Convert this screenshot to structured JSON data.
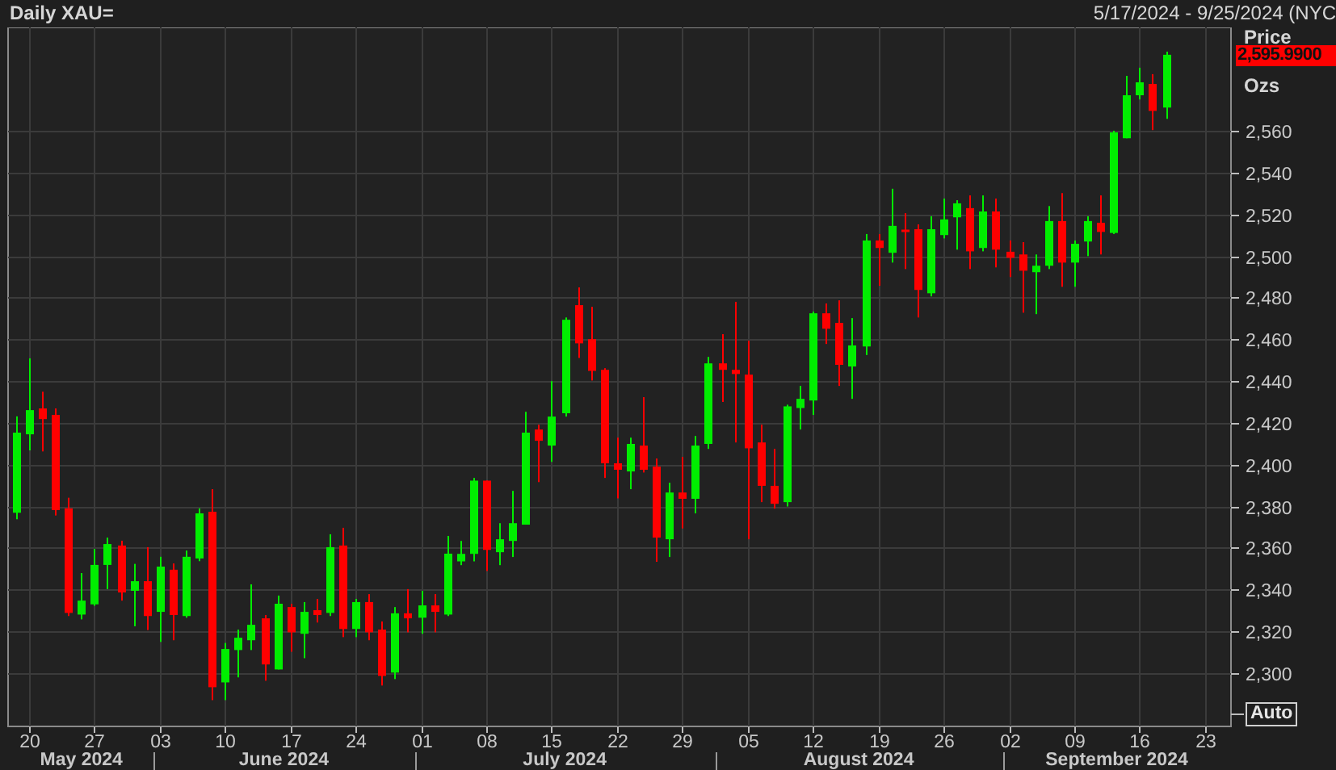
{
  "header": {
    "title": "Daily XAU=",
    "date_range": "5/17/2024 - 9/25/2024 (NYC"
  },
  "chart": {
    "price_axis": {
      "title": "Price",
      "last_price": "2,595.9900",
      "unit": "Ozs",
      "auto_button": "Auto"
    },
    "chart_data": {
      "type": "candlestick",
      "grid": true,
      "ylim": [
        2274.5,
        2609.5
      ],
      "categories": [
        null,
        "20",
        null,
        null,
        null,
        null,
        "27",
        null,
        null,
        null,
        null,
        "03",
        null,
        null,
        null,
        null,
        "10",
        null,
        null,
        null,
        null,
        "17",
        null,
        null,
        null,
        null,
        "24",
        null,
        null,
        null,
        null,
        "01",
        null,
        null,
        null,
        null,
        "08",
        null,
        null,
        null,
        null,
        "15",
        null,
        null,
        null,
        null,
        "22",
        null,
        null,
        null,
        null,
        "29",
        null,
        null,
        null,
        null,
        "05",
        null,
        null,
        null,
        null,
        "12",
        null,
        null,
        null,
        null,
        "19",
        null,
        null,
        null,
        null,
        "26",
        null,
        null,
        null,
        null,
        "02",
        null,
        null,
        null,
        null,
        "09",
        null,
        null,
        null,
        null,
        "16",
        null,
        null,
        null,
        null,
        "23"
      ],
      "ohlc": [
        [
          2376.9,
          2423.1,
          2373.8,
          2415.3
        ],
        [
          2414.5,
          2450.9,
          2406.8,
          2426.1
        ],
        [
          2426.9,
          2434.9,
          2406.3,
          2421.8
        ],
        [
          2423.8,
          2426.9,
          2375.6,
          2378.2
        ],
        [
          2379.0,
          2384.1,
          2327.4,
          2328.9
        ],
        [
          2328.1,
          2348.0,
          2325.8,
          2334.8
        ],
        [
          2333.0,
          2359.6,
          2332.3,
          2351.9
        ],
        [
          2351.9,
          2365.0,
          2340.3,
          2361.9
        ],
        [
          2361.2,
          2363.5,
          2334.8,
          2338.7
        ],
        [
          2339.5,
          2352.4,
          2322.5,
          2344.1
        ],
        [
          2344.1,
          2360.4,
          2320.7,
          2327.4
        ],
        [
          2329.4,
          2355.8,
          2315.0,
          2351.1
        ],
        [
          2349.6,
          2352.6,
          2315.8,
          2327.9
        ],
        [
          2327.4,
          2358.8,
          2326.6,
          2355.8
        ],
        [
          2355.0,
          2379.0,
          2353.7,
          2376.6
        ],
        [
          2377.4,
          2388.2,
          2287.1,
          2293.3
        ],
        [
          2295.6,
          2314.5,
          2287.1,
          2311.6
        ],
        [
          2311.1,
          2320.9,
          2298.0,
          2317.0
        ],
        [
          2315.8,
          2342.6,
          2311.1,
          2323.2
        ],
        [
          2326.3,
          2327.9,
          2296.4,
          2304.2
        ],
        [
          2301.8,
          2337.2,
          2301.8,
          2333.3
        ],
        [
          2331.7,
          2333.3,
          2310.3,
          2319.6
        ],
        [
          2318.9,
          2334.1,
          2307.2,
          2329.4
        ],
        [
          2330.2,
          2335.6,
          2324.3,
          2327.9
        ],
        [
          2328.9,
          2366.6,
          2327.4,
          2360.4
        ],
        [
          2361.2,
          2369.7,
          2317.3,
          2321.2
        ],
        [
          2321.2,
          2335.6,
          2317.3,
          2334.1
        ],
        [
          2334.1,
          2337.9,
          2315.8,
          2319.6
        ],
        [
          2320.9,
          2324.8,
          2294.1,
          2298.7
        ],
        [
          2300.3,
          2331.7,
          2297.2,
          2328.7
        ],
        [
          2328.7,
          2340.3,
          2319.6,
          2326.3
        ],
        [
          2326.6,
          2339.5,
          2318.9,
          2332.5
        ],
        [
          2332.5,
          2337.9,
          2319.6,
          2329.4
        ],
        [
          2328.1,
          2365.8,
          2327.4,
          2357.3
        ],
        [
          2353.6,
          2363.4,
          2351.8,
          2357.2
        ],
        [
          2357.2,
          2393.6,
          2353.6,
          2392.3
        ],
        [
          2392.3,
          2392.3,
          2349.0,
          2359.1
        ],
        [
          2358.0,
          2371.9,
          2351.8,
          2364.2
        ],
        [
          2363.4,
          2387.4,
          2355.7,
          2371.9
        ],
        [
          2371.2,
          2425.3,
          2371.2,
          2415.3
        ],
        [
          2416.8,
          2419.1,
          2391.6,
          2411.4
        ],
        [
          2409.1,
          2440.0,
          2401.3,
          2423.0
        ],
        [
          2424.6,
          2470.5,
          2423.0,
          2469.4
        ],
        [
          2476.4,
          2484.9,
          2451.1,
          2458.1
        ],
        [
          2460.1,
          2475.6,
          2440.3,
          2444.9
        ],
        [
          2445.4,
          2446.2,
          2393.6,
          2400.6
        ],
        [
          2400.6,
          2412.9,
          2383.8,
          2397.5
        ],
        [
          2396.7,
          2412.9,
          2388.2,
          2409.9
        ],
        [
          2409.1,
          2432.3,
          2396.2,
          2397.5
        ],
        [
          2399.0,
          2402.9,
          2353.4,
          2365.0
        ],
        [
          2364.2,
          2391.3,
          2355.7,
          2386.6
        ],
        [
          2386.6,
          2403.7,
          2369.4,
          2383.6
        ],
        [
          2383.6,
          2413.7,
          2376.6,
          2409.1
        ],
        [
          2409.9,
          2451.6,
          2407.5,
          2448.5
        ],
        [
          2448.5,
          2462.5,
          2430.0,
          2445.4
        ],
        [
          2445.4,
          2478.0,
          2410.6,
          2443.4
        ],
        [
          2443.1,
          2459.4,
          2364.2,
          2407.8
        ],
        [
          2410.6,
          2419.1,
          2382.0,
          2389.8
        ],
        [
          2389.8,
          2407.5,
          2378.9,
          2381.2
        ],
        [
          2382.0,
          2428.7,
          2379.9,
          2427.9
        ],
        [
          2427.1,
          2437.7,
          2416.8,
          2431.5
        ],
        [
          2430.7,
          2473.3,
          2423.8,
          2472.5
        ],
        [
          2472.5,
          2477.2,
          2457.8,
          2465.1
        ],
        [
          2467.9,
          2478.7,
          2437.7,
          2447.8
        ],
        [
          2447.0,
          2470.2,
          2431.5,
          2457.1
        ],
        [
          2456.6,
          2510.5,
          2452.5,
          2507.4
        ],
        [
          2507.4,
          2510.5,
          2485.7,
          2503.8
        ],
        [
          2501.5,
          2532.2,
          2496.8,
          2514.4
        ],
        [
          2512.6,
          2520.5,
          2493.7,
          2512.0
        ],
        [
          2512.8,
          2515.1,
          2470.5,
          2483.7
        ],
        [
          2482.1,
          2519.0,
          2480.6,
          2512.8
        ],
        [
          2510.0,
          2527.5,
          2508.4,
          2517.5
        ],
        [
          2518.5,
          2526.7,
          2503.0,
          2525.2
        ],
        [
          2522.9,
          2529.0,
          2493.7,
          2502.2
        ],
        [
          2503.8,
          2529.0,
          2502.2,
          2521.3
        ],
        [
          2521.3,
          2527.5,
          2494.5,
          2503.0
        ],
        [
          2502.0,
          2507.4,
          2489.9,
          2499.1
        ],
        [
          2500.7,
          2506.6,
          2472.8,
          2492.9
        ],
        [
          2492.2,
          2500.7,
          2472.1,
          2495.3
        ],
        [
          2495.3,
          2523.9,
          2493.7,
          2516.7
        ],
        [
          2516.7,
          2530.1,
          2485.2,
          2496.8
        ],
        [
          2496.8,
          2507.4,
          2485.2,
          2505.8
        ],
        [
          2506.9,
          2519.0,
          2499.9,
          2516.7
        ],
        [
          2515.9,
          2529.0,
          2500.7,
          2511.5
        ],
        [
          2511.0,
          2560.0,
          2510.5,
          2559.2
        ],
        [
          2556.4,
          2586.3,
          2556.4,
          2577.0
        ],
        [
          2577.0,
          2590.2,
          2575.0,
          2583.2
        ],
        [
          2582.4,
          2587.1,
          2560.3,
          2569.5
        ],
        [
          2571.1,
          2597.9,
          2565.7,
          2596.4
        ],
        null,
        null,
        null
      ],
      "yticks": [
        {
          "value": 2300,
          "label": "2,300"
        },
        {
          "value": 2320,
          "label": "2,320"
        },
        {
          "value": 2340,
          "label": "2,340"
        },
        {
          "value": 2360,
          "label": "2,360"
        },
        {
          "value": 2380,
          "label": "2,380"
        },
        {
          "value": 2400,
          "label": "2,400"
        },
        {
          "value": 2420,
          "label": "2,420"
        },
        {
          "value": 2440,
          "label": "2,440"
        },
        {
          "value": 2460,
          "label": "2,460"
        },
        {
          "value": 2480,
          "label": "2,480"
        },
        {
          "value": 2500,
          "label": "2,500"
        },
        {
          "value": 2520,
          "label": "2,520"
        },
        {
          "value": 2540,
          "label": "2,540"
        },
        {
          "value": 2560,
          "label": "2,560"
        }
      ],
      "annotations": [
        "May 2024",
        "June 2024",
        "July 2024",
        "August 2024",
        "September 2024"
      ]
    }
  }
}
